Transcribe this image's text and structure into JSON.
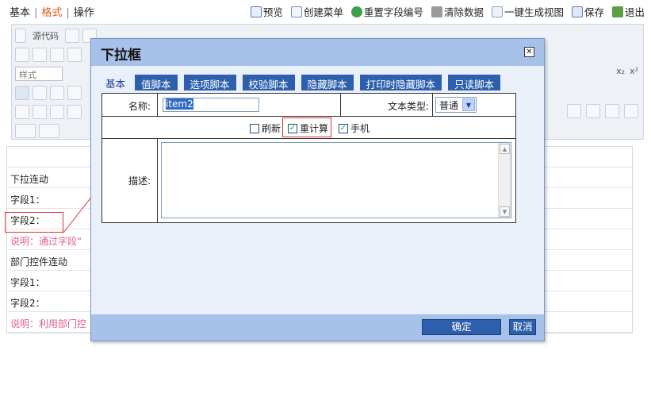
{
  "top_tabs": [
    {
      "label": "基本"
    },
    {
      "label": "格式"
    },
    {
      "label": "操作"
    }
  ],
  "top_actions": [
    {
      "label": "预览",
      "icon": "preview-icon",
      "color": "#4a7fc1"
    },
    {
      "label": "创建菜单",
      "icon": "menu-create-icon",
      "color": "#6a8fc8"
    },
    {
      "label": "重置字段编号",
      "icon": "reset-icon",
      "color": "#3aa04a"
    },
    {
      "label": "清除数据",
      "icon": "trash-icon",
      "color": "#777777"
    },
    {
      "label": "一键生成视图",
      "icon": "view-generate-icon",
      "color": "#8aa0c8"
    },
    {
      "label": "保存",
      "icon": "save-icon",
      "color": "#5b7fb5"
    },
    {
      "label": "退出",
      "icon": "exit-icon",
      "color": "#5aa044"
    }
  ],
  "editor_toolbar": {
    "source_label": "源代码",
    "style_placeholder": "样式"
  },
  "content_rows": [
    {
      "text": "下拉连动",
      "note": false
    },
    {
      "text": "字段1：",
      "note": false
    },
    {
      "text": "字段2：",
      "note": false
    },
    {
      "text": "说明：通过字段“",
      "note": true
    },
    {
      "text": "部门控件连动",
      "note": false
    },
    {
      "text": "字段1：",
      "note": false
    },
    {
      "text": "字段2：",
      "note": false
    },
    {
      "text": "说明：利用部门控",
      "note": true
    }
  ],
  "dialog": {
    "title": "下拉框",
    "tabs": [
      {
        "label": "基本",
        "plain": true
      },
      {
        "label": "值脚本",
        "plain": false
      },
      {
        "label": "选项脚本",
        "plain": false
      },
      {
        "label": "校验脚本",
        "plain": false
      },
      {
        "label": "隐藏脚本",
        "plain": false
      },
      {
        "label": "打印时隐藏脚本",
        "plain": false
      },
      {
        "label": "只读脚本",
        "plain": false
      }
    ],
    "name_label": "名称:",
    "name_value": "item2",
    "text_type_label": "文本类型:",
    "text_type_value": "普通",
    "checkboxes": [
      {
        "label": "刷新",
        "checked": false
      },
      {
        "label": "重计算",
        "checked": true
      },
      {
        "label": "手机",
        "checked": true
      }
    ],
    "desc_label": "描述:",
    "desc_value": "",
    "ok_label": "确定",
    "cancel_label": "取消"
  },
  "colors": {
    "dialog_header": "#a8c1ea",
    "tab_button": "#2e5fad",
    "active_tab": "#e05a1a",
    "note_text": "#e0608a",
    "highlight": "#dd3333"
  }
}
